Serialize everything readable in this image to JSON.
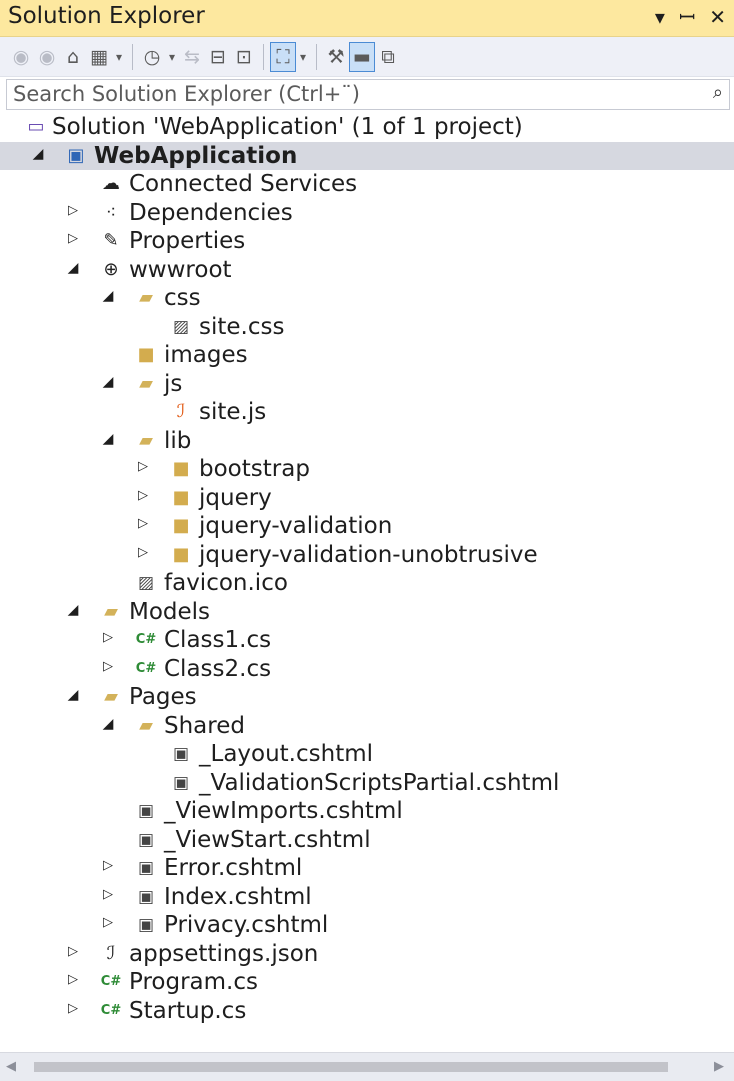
{
  "panel": {
    "title": "Solution Explorer",
    "controls": [
      {
        "name": "dropdown-icon",
        "glyph": "▾"
      },
      {
        "name": "pin-icon",
        "glyph": "ꟷ"
      },
      {
        "name": "close-icon",
        "glyph": "✕"
      }
    ]
  },
  "toolbar": {
    "buttons": [
      {
        "name": "back-icon",
        "glyph": "◉",
        "dim": true
      },
      {
        "name": "forward-icon",
        "glyph": "◉",
        "dim": true
      },
      {
        "name": "home-icon",
        "glyph": "⌂"
      },
      {
        "name": "switch-views-icon",
        "glyph": "▦"
      },
      {
        "name": "switch-views-dropdown",
        "glyph": "▾",
        "drop": true
      },
      {
        "sep": true
      },
      {
        "name": "pending-changes-icon",
        "glyph": "◷"
      },
      {
        "name": "pending-changes-dropdown",
        "glyph": "▾",
        "drop": true
      },
      {
        "name": "sync-icon",
        "glyph": "⇆",
        "dim": true
      },
      {
        "name": "collapse-all-icon",
        "glyph": "⊟"
      },
      {
        "name": "show-all-files-icon",
        "glyph": "⊡"
      },
      {
        "sep": true
      },
      {
        "name": "filter-icon",
        "glyph": "⛶",
        "on": true
      },
      {
        "name": "filter-dropdown",
        "glyph": "▾",
        "drop": true
      },
      {
        "sep": true
      },
      {
        "name": "properties-wrench-icon",
        "glyph": "⚒"
      },
      {
        "name": "preview-selected-icon",
        "glyph": "▬",
        "on": true
      },
      {
        "name": "class-diagram-icon",
        "glyph": "⧉"
      }
    ]
  },
  "search": {
    "placeholder": "Search Solution Explorer (Ctrl+¨)",
    "icon": "⌕"
  },
  "tree": [
    {
      "label": "Solution 'WebApplication' (1 of 1 project)",
      "depth": 0,
      "arrow": "",
      "icon": "sln"
    },
    {
      "label": "WebApplication",
      "depth": 1,
      "arrow": "exp",
      "icon": "proj",
      "bold": true,
      "selected": true
    },
    {
      "label": "Connected Services",
      "depth": 2,
      "arrow": "",
      "icon": "cloud"
    },
    {
      "label": "Dependencies",
      "depth": 2,
      "arrow": "col",
      "icon": "deps"
    },
    {
      "label": "Properties",
      "depth": 2,
      "arrow": "col",
      "icon": "wrench"
    },
    {
      "label": "wwwroot",
      "depth": 2,
      "arrow": "exp",
      "icon": "globe"
    },
    {
      "label": "css",
      "depth": 3,
      "arrow": "exp",
      "icon": "folder-open"
    },
    {
      "label": "site.css",
      "depth": 4,
      "arrow": "",
      "icon": "css"
    },
    {
      "label": "images",
      "depth": 3,
      "arrow": "",
      "icon": "folder"
    },
    {
      "label": "js",
      "depth": 3,
      "arrow": "exp",
      "icon": "folder-open"
    },
    {
      "label": "site.js",
      "depth": 4,
      "arrow": "",
      "icon": "js"
    },
    {
      "label": "lib",
      "depth": 3,
      "arrow": "exp",
      "icon": "folder-open"
    },
    {
      "label": "bootstrap",
      "depth": 4,
      "arrow": "col",
      "icon": "folder"
    },
    {
      "label": "jquery",
      "depth": 4,
      "arrow": "col",
      "icon": "folder"
    },
    {
      "label": "jquery-validation",
      "depth": 4,
      "arrow": "col",
      "icon": "folder"
    },
    {
      "label": "jquery-validation-unobtrusive",
      "depth": 4,
      "arrow": "col",
      "icon": "folder"
    },
    {
      "label": "favicon.ico",
      "depth": 3,
      "arrow": "",
      "icon": "image"
    },
    {
      "label": "Models",
      "depth": 2,
      "arrow": "exp",
      "icon": "folder-open"
    },
    {
      "label": "Class1.cs",
      "depth": 3,
      "arrow": "col",
      "icon": "csharp"
    },
    {
      "label": "Class2.cs",
      "depth": 3,
      "arrow": "col",
      "icon": "csharp"
    },
    {
      "label": "Pages",
      "depth": 2,
      "arrow": "exp",
      "icon": "folder-open"
    },
    {
      "label": "Shared",
      "depth": 3,
      "arrow": "exp",
      "icon": "folder-open"
    },
    {
      "label": "_Layout.cshtml",
      "depth": 4,
      "arrow": "",
      "icon": "razor"
    },
    {
      "label": "_ValidationScriptsPartial.cshtml",
      "depth": 4,
      "arrow": "",
      "icon": "razor"
    },
    {
      "label": "_ViewImports.cshtml",
      "depth": 3,
      "arrow": "",
      "icon": "razor"
    },
    {
      "label": "_ViewStart.cshtml",
      "depth": 3,
      "arrow": "",
      "icon": "razor"
    },
    {
      "label": "Error.cshtml",
      "depth": 3,
      "arrow": "col",
      "icon": "razor"
    },
    {
      "label": "Index.cshtml",
      "depth": 3,
      "arrow": "col",
      "icon": "razor"
    },
    {
      "label": "Privacy.cshtml",
      "depth": 3,
      "arrow": "col",
      "icon": "razor"
    },
    {
      "label": "appsettings.json",
      "depth": 2,
      "arrow": "col",
      "icon": "json"
    },
    {
      "label": "Program.cs",
      "depth": 2,
      "arrow": "col",
      "icon": "csharp"
    },
    {
      "label": "Startup.cs",
      "depth": 2,
      "arrow": "col",
      "icon": "csharp"
    }
  ],
  "colors": {
    "title_bar": "#fde89f",
    "toolbar": "#eef0f7",
    "selection": "#d6d8e0",
    "folder": "#d3ac4e",
    "csharp": "#2e8b36",
    "js": "#e25b16"
  }
}
